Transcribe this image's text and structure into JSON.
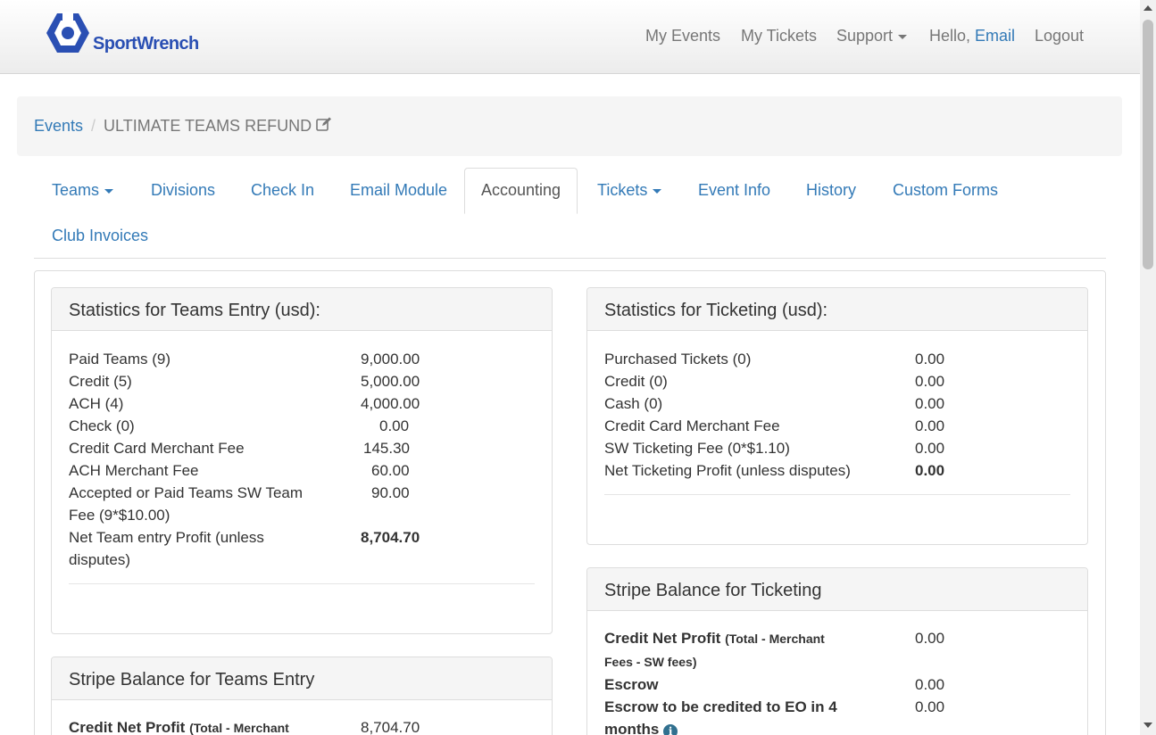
{
  "logo": {
    "text": "SportWrench",
    "icon": "hexagon-wrench-icon",
    "color": "#2a4fb3"
  },
  "nav": {
    "my_events": "My Events",
    "my_tickets": "My Tickets",
    "support": "Support",
    "hello": "Hello,",
    "user": "Email",
    "logout": "Logout"
  },
  "breadcrumb": {
    "events": "Events",
    "current": "ULTIMATE TEAMS REFUND"
  },
  "tabs": {
    "teams": "Teams",
    "divisions": "Divisions",
    "check_in": "Check In",
    "email_module": "Email Module",
    "accounting": "Accounting",
    "tickets": "Tickets",
    "event_info": "Event Info",
    "history": "History",
    "custom_forms": "Custom Forms",
    "club_invoices": "Club Invoices",
    "active": "Accounting"
  },
  "teams_stats": {
    "title": "Statistics for Teams Entry (usd):",
    "rows": [
      {
        "label": "Paid Teams (9)",
        "value": "9,000.00"
      },
      {
        "label": "Credit (5)",
        "value": "5,000.00"
      },
      {
        "label": "ACH (4)",
        "value": "4,000.00"
      },
      {
        "label": "Check (0)",
        "value": "0.00"
      },
      {
        "label": "Credit Card Merchant Fee",
        "value": "145.30"
      },
      {
        "label": "ACH Merchant Fee",
        "value": "60.00"
      },
      {
        "label": "Accepted or Paid Teams SW Team Fee (9*$10.00)",
        "value": "90.00"
      },
      {
        "label": "Net Team entry Profit (unless disputes)",
        "value": "8,704.70"
      }
    ]
  },
  "ticket_stats": {
    "title": "Statistics for Ticketing (usd):",
    "rows": [
      {
        "label": "Purchased Tickets (0)",
        "value": "0.00"
      },
      {
        "label": "Credit (0)",
        "value": "0.00"
      },
      {
        "label": "Cash (0)",
        "value": "0.00"
      },
      {
        "label": "Credit Card Merchant Fee",
        "value": "0.00"
      },
      {
        "label": "SW Ticketing Fee (0*$1.10)",
        "value": "0.00"
      },
      {
        "label": "Net Ticketing Profit (unless disputes)",
        "value": "0.00"
      }
    ]
  },
  "stripe_tickets": {
    "title": "Stripe Balance for Ticketing",
    "credit_label": "Credit Net Profit",
    "credit_note": "(Total - Merchant Fees - SW fees)",
    "credit_value": "0.00",
    "escrow_label": "Escrow",
    "escrow_value": "0.00",
    "escrow_credit_label": "Escrow to be credited to EO in 4 months",
    "escrow_credit_value": "0.00",
    "info_icon": "info-circle-icon"
  },
  "stripe_teams": {
    "title": "Stripe Balance for Teams Entry",
    "credit_label": "Credit Net Profit",
    "credit_note": "(Total - Merchant",
    "credit_value": "8,704.70"
  }
}
